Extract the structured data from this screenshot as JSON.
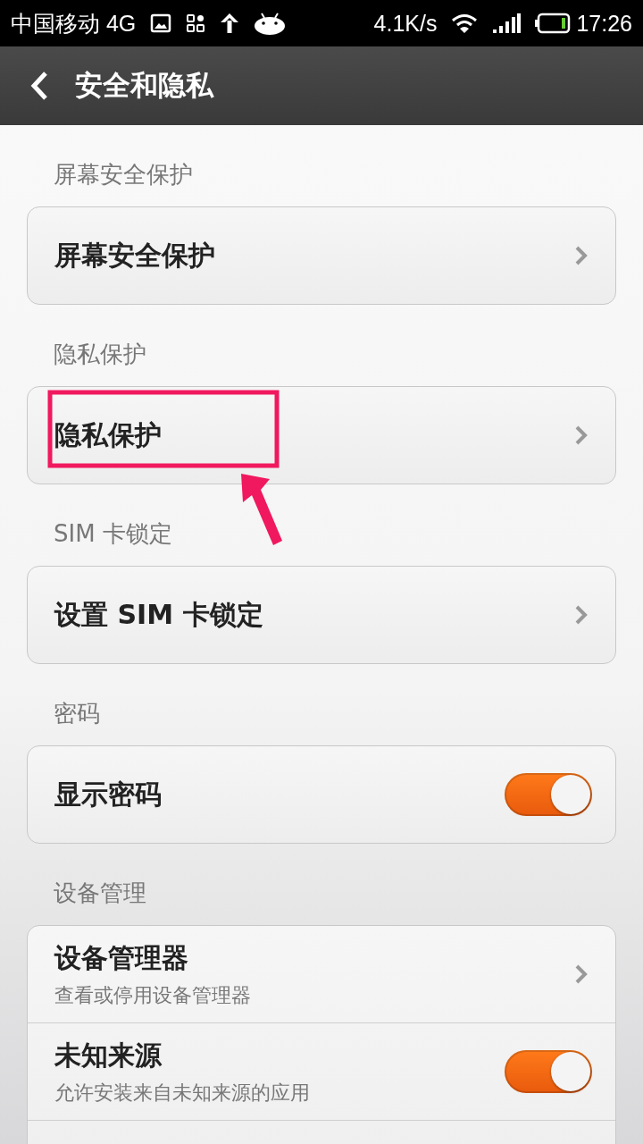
{
  "status_bar": {
    "carrier": "中国移动 4G",
    "speed": "4.1K/s",
    "time": "17:26"
  },
  "header": {
    "title": "安全和隐私"
  },
  "sections": [
    {
      "label": "屏幕安全保护",
      "rows": [
        {
          "kind": "link",
          "title": "屏幕安全保护"
        }
      ]
    },
    {
      "label": "隐私保护",
      "rows": [
        {
          "kind": "link",
          "title": "隐私保护"
        }
      ]
    },
    {
      "label": "SIM 卡锁定",
      "rows": [
        {
          "kind": "link",
          "title": "设置 SIM 卡锁定"
        }
      ]
    },
    {
      "label": "密码",
      "rows": [
        {
          "kind": "switch",
          "title": "显示密码",
          "on": true
        }
      ]
    },
    {
      "label": "设备管理",
      "rows": [
        {
          "kind": "link",
          "title": "设备管理器",
          "subtitle": "查看或停用设备管理器"
        },
        {
          "kind": "switch",
          "title": "未知来源",
          "subtitle": "允许安装来自未知来源的应用",
          "on": true
        },
        {
          "kind": "cut"
        }
      ]
    }
  ]
}
